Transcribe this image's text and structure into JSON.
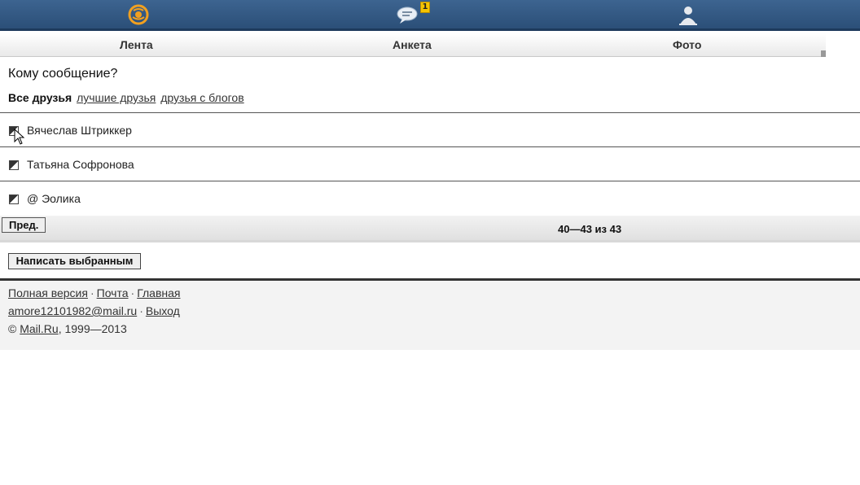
{
  "header": {
    "icons": [
      "world-icon",
      "chat-icon",
      "user-icon"
    ],
    "badge": "1"
  },
  "tabs": [
    {
      "label": "Лента"
    },
    {
      "label": "Анкета"
    },
    {
      "label": "Фото"
    }
  ],
  "main": {
    "title": "Кому сообщение?",
    "filters": {
      "current": "Все друзья",
      "best": "лучшие друзья",
      "blogs": "друзья с блогов"
    },
    "friends": [
      {
        "name": "Вячеслав Штриккер"
      },
      {
        "name": "Татьяна Софронова"
      },
      {
        "name": "@ Эолика"
      }
    ],
    "pager": {
      "prev_label": "Пред.",
      "count": "40—43 из 43"
    },
    "send_label": "Написать выбранным"
  },
  "footer": {
    "full_version": "Полная версия",
    "mail": "Почта",
    "home": "Главная",
    "email": "amore12101982@mail.ru",
    "logout": "Выход",
    "copyright_prefix": "©",
    "brand": "Mail.Ru",
    "years": ", 1999—2013"
  },
  "colors": {
    "header_bg": "#2b4f78",
    "icon_orange": "#f0a020",
    "badge": "#f5c400"
  }
}
